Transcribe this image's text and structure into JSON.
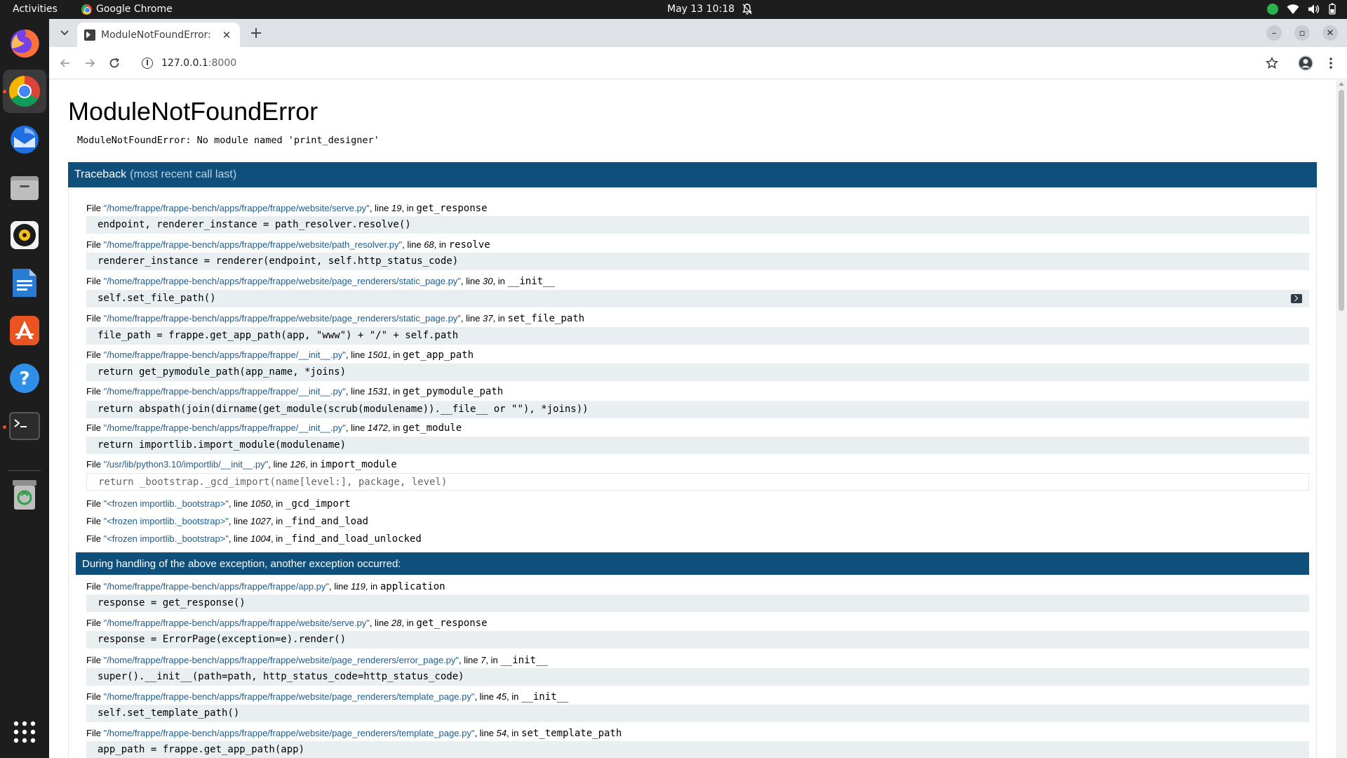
{
  "topbar": {
    "activities": "Activities",
    "app_name": "Google Chrome",
    "clock": "May 13  10:18"
  },
  "dock": {
    "items": [
      "firefox-icon",
      "chrome-icon",
      "thunderbird-icon",
      "files-icon",
      "rhythmbox-icon",
      "writer-icon",
      "app-center-icon",
      "help-icon",
      "terminal-icon",
      "trash-icon",
      "show-apps-icon"
    ]
  },
  "browser": {
    "tab_title": "ModuleNotFoundError: N",
    "url_host": "127.0.0.1",
    "url_port": ":8000"
  },
  "page": {
    "title": "ModuleNotFoundError",
    "exception": "ModuleNotFoundError: No module named 'print_designer'",
    "traceback_label": "Traceback",
    "traceback_sub": "(most recent call last)",
    "during_handling": "During handling of the above exception, another exception occurred:",
    "frames": [
      {
        "path": "\"/home/frappe/frappe-bench/apps/frappe/frappe/website/serve.py\"",
        "line": "19",
        "func": "get_response",
        "code": "endpoint, renderer_instance = path_resolver.resolve()"
      },
      {
        "path": "\"/home/frappe/frappe-bench/apps/frappe/frappe/website/path_resolver.py\"",
        "line": "68",
        "func": "resolve",
        "code": "renderer_instance = renderer(endpoint, self.http_status_code)"
      },
      {
        "path": "\"/home/frappe/frappe-bench/apps/frappe/frappe/website/page_renderers/static_page.py\"",
        "line": "30",
        "func": "__init__",
        "code": "self.set_file_path()"
      },
      {
        "path": "\"/home/frappe/frappe-bench/apps/frappe/frappe/website/page_renderers/static_page.py\"",
        "line": "37",
        "func": "set_file_path",
        "code": "file_path = frappe.get_app_path(app, \"www\") + \"/\" + self.path"
      },
      {
        "path": "\"/home/frappe/frappe-bench/apps/frappe/frappe/__init__.py\"",
        "line": "1501",
        "func": "get_app_path",
        "code": "return get_pymodule_path(app_name, *joins)"
      },
      {
        "path": "\"/home/frappe/frappe-bench/apps/frappe/frappe/__init__.py\"",
        "line": "1531",
        "func": "get_pymodule_path",
        "code": "return abspath(join(dirname(get_module(scrub(modulename)).__file__ or \"\"), *joins))"
      },
      {
        "path": "\"/home/frappe/frappe-bench/apps/frappe/frappe/__init__.py\"",
        "line": "1472",
        "func": "get_module",
        "code": "return importlib.import_module(modulename)"
      },
      {
        "path": "\"/usr/lib/python3.10/importlib/__init__.py\"",
        "line": "126",
        "func": "import_module",
        "code": "return _bootstrap._gcd_import(name[level:], package, level)"
      },
      {
        "path": "\"<frozen importlib._bootstrap>\"",
        "line": "1050",
        "func": "_gcd_import",
        "code": ""
      },
      {
        "path": "\"<frozen importlib._bootstrap>\"",
        "line": "1027",
        "func": "_find_and_load",
        "code": ""
      },
      {
        "path": "\"<frozen importlib._bootstrap>\"",
        "line": "1004",
        "func": "_find_and_load_unlocked",
        "code": ""
      }
    ],
    "frames2": [
      {
        "path": "\"/home/frappe/frappe-bench/apps/frappe/frappe/app.py\"",
        "line": "119",
        "func": "application",
        "code": "response = get_response()"
      },
      {
        "path": "\"/home/frappe/frappe-bench/apps/frappe/frappe/website/serve.py\"",
        "line": "28",
        "func": "get_response",
        "code": "response = ErrorPage(exception=e).render()"
      },
      {
        "path": "\"/home/frappe/frappe-bench/apps/frappe/frappe/website/page_renderers/error_page.py\"",
        "line": "7",
        "func": "__init__",
        "code": "super().__init__(path=path, http_status_code=http_status_code)"
      },
      {
        "path": "\"/home/frappe/frappe-bench/apps/frappe/frappe/website/page_renderers/template_page.py\"",
        "line": "45",
        "func": "__init__",
        "code": "self.set_template_path()"
      },
      {
        "path": "\"/home/frappe/frappe-bench/apps/frappe/frappe/website/page_renderers/template_page.py\"",
        "line": "54",
        "func": "set_template_path",
        "code": "app_path = frappe.get_app_path(app)"
      }
    ],
    "file_word": "File",
    "line_word": "line",
    "in_word": "in"
  },
  "colors": {
    "header_band": "#0e4f7c",
    "path_link": "#1c5c8f",
    "code_bg": "#e9eef1"
  }
}
